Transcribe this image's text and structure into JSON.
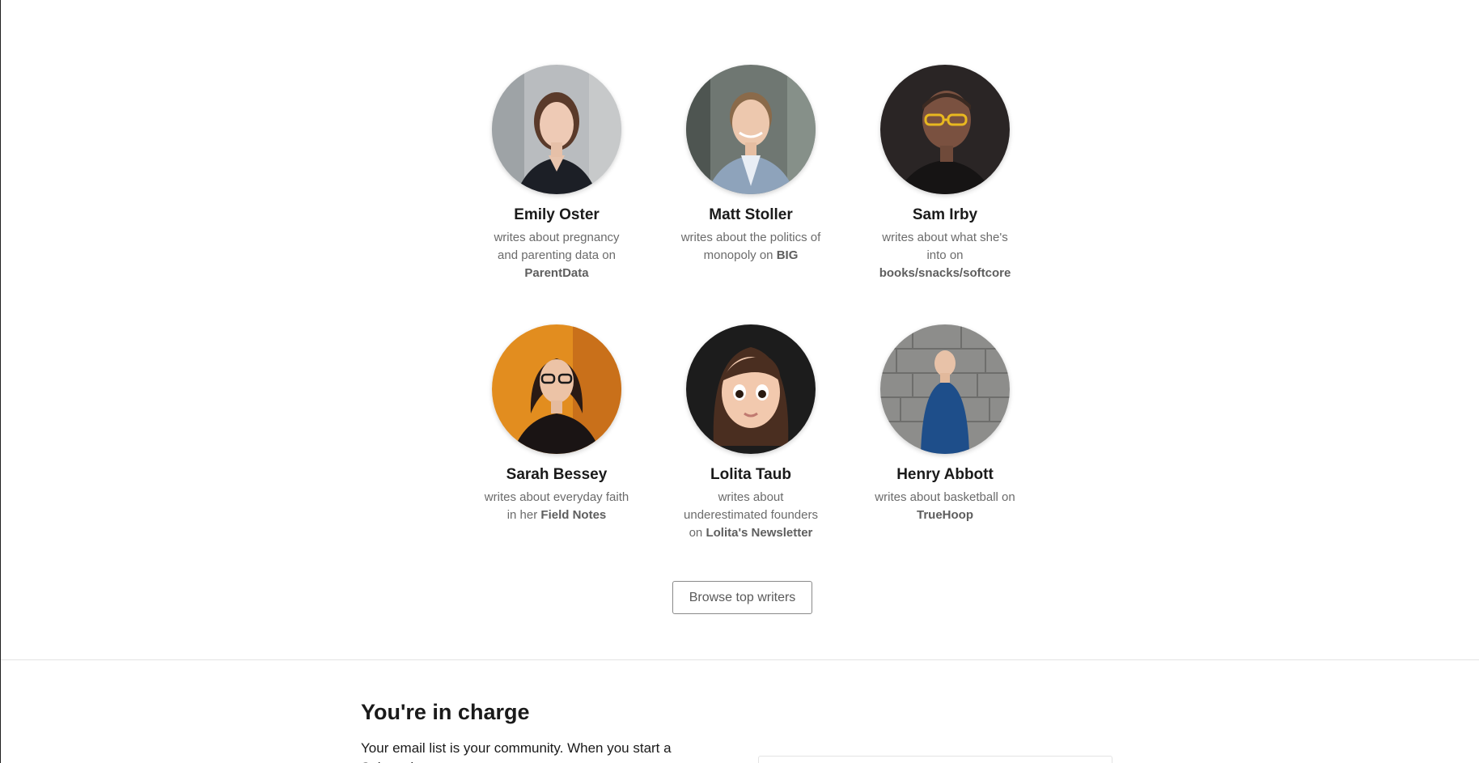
{
  "writers": [
    {
      "name": "Emily Oster",
      "desc_pre": "writes about pregnancy and parenting data on ",
      "publication": "ParentData",
      "avatar": "emily-oster-avatar"
    },
    {
      "name": "Matt Stoller",
      "desc_pre": "writes about the politics of monopoly on ",
      "publication": "BIG",
      "avatar": "matt-stoller-avatar"
    },
    {
      "name": "Sam Irby",
      "desc_pre": "writes about what she's into on ",
      "publication": "books/snacks/softcore",
      "avatar": "sam-irby-avatar"
    },
    {
      "name": "Sarah Bessey",
      "desc_pre": "writes about everyday faith in her ",
      "publication": "Field Notes",
      "avatar": "sarah-bessey-avatar"
    },
    {
      "name": "Lolita Taub",
      "desc_pre": "writes about underestimated founders on ",
      "publication": "Lolita's Newsletter",
      "avatar": "lolita-taub-avatar"
    },
    {
      "name": "Henry Abbott",
      "desc_pre": "writes about basketball on ",
      "publication": "TrueHoop",
      "avatar": "henry-abbott-avatar"
    }
  ],
  "browse_button": {
    "label": "Browse top writers"
  },
  "section": {
    "title": "You're in charge",
    "text": "Your email list is your community. When you start a Substack"
  }
}
